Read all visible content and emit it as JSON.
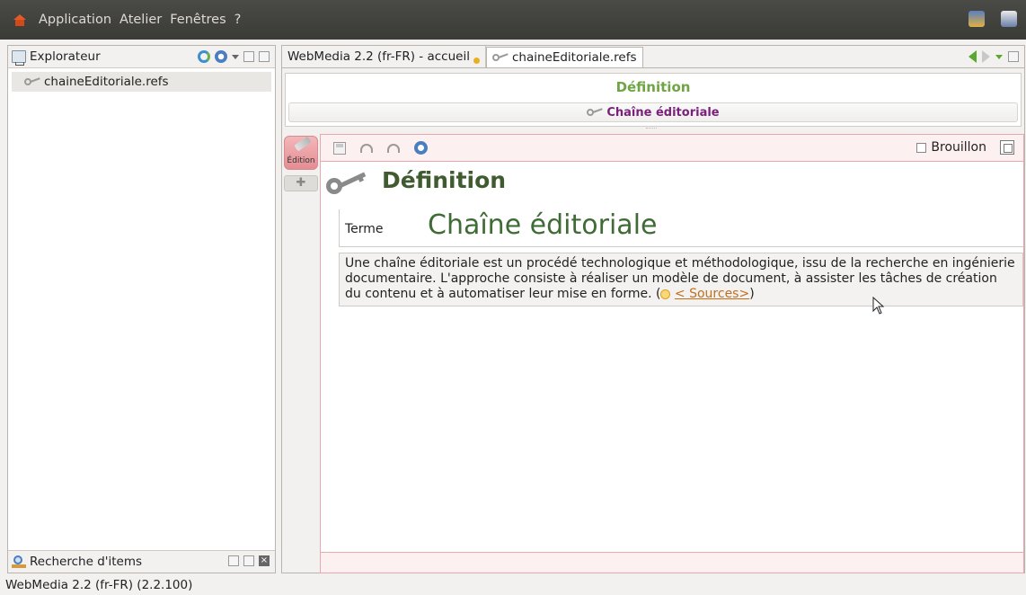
{
  "menubar": {
    "items": [
      "Application",
      "Atelier",
      "Fenêtres",
      "?"
    ],
    "home_icon": "home-icon",
    "right_icons": [
      "network-icon",
      "user-icon"
    ]
  },
  "explorer": {
    "title": "Explorateur",
    "items": [
      {
        "label": "chaineEditoriale.refs",
        "icon": "key-icon"
      }
    ],
    "tools": [
      "refresh-icon",
      "navigate-icon",
      "dropdown-icon",
      "minimize-icon",
      "maximize-icon"
    ]
  },
  "search_panel": {
    "title": "Recherche d'items",
    "tools": [
      "minimize-icon",
      "maximize-icon",
      "close-icon"
    ]
  },
  "editor_tabs": [
    {
      "label": "WebMedia 2.2 (fr-FR) - accueil",
      "active": false
    },
    {
      "label": "chaineEditoriale.refs",
      "active": true
    }
  ],
  "breadcrumb": {
    "title": "Définition",
    "item": "Chaîne éditoriale"
  },
  "mode_bar": {
    "edit_label": "Édition"
  },
  "document": {
    "draft_label": "Brouillon",
    "draft_checked": false,
    "heading": "Définition",
    "term_label": "Terme",
    "term_value": "Chaîne éditoriale",
    "body": "Une chaîne éditoriale est un procédé technologique et méthodologique, issu de la recherche en ingénierie documentaire. L'approche consiste à réaliser un modèle de document, à assister les tâches de création du contenu et à automatiser leur mise en forme. (",
    "source_link": "< Sources>",
    "body_end": ")"
  },
  "colors": {
    "accent_green": "#6fa544",
    "heading_green": "#3f5b2f",
    "term_green": "#3f6b35",
    "breadcrumb_purple": "#7a1f7a",
    "editor_border_pink": "#e7a9ad",
    "link_orange": "#c0701a"
  },
  "statusbar": {
    "text": "WebMedia 2.2 (fr-FR) (2.2.100)"
  }
}
